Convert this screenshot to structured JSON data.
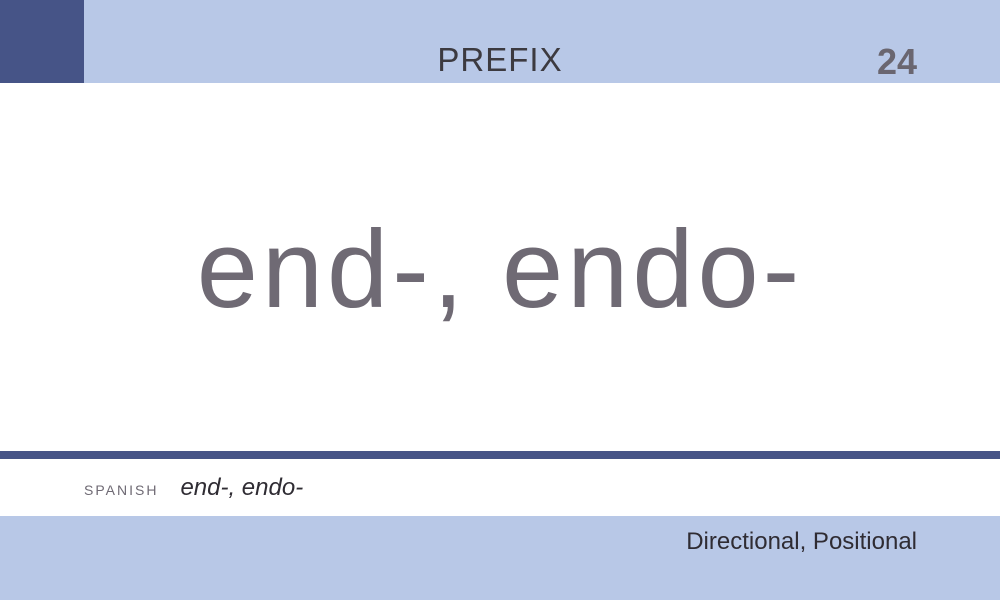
{
  "card": {
    "category": "PREFIX",
    "number": "24",
    "term": "end-, endo-",
    "spanish_label": "SPANISH",
    "spanish_term": "end-, endo-",
    "footer_category": "Directional, Positional"
  },
  "colors": {
    "band": "#b8c8e7",
    "accent": "#465487",
    "text_dark": "#2f2c33",
    "term_gray": "#6f6a74"
  }
}
